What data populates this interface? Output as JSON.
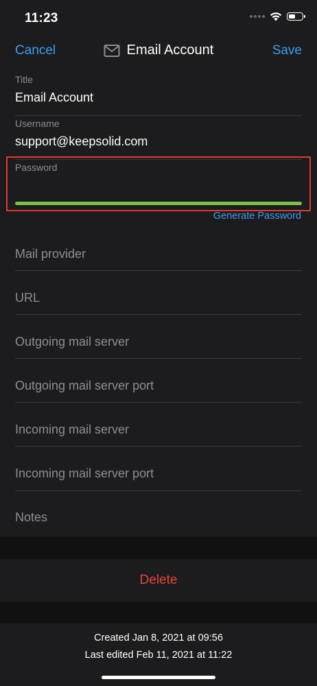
{
  "status_bar": {
    "time": "11:23",
    "battery_level_percent": 55,
    "icons": [
      "cellular-dots-icon",
      "wifi-icon",
      "battery-icon"
    ]
  },
  "nav": {
    "cancel_label": "Cancel",
    "title": "Email Account",
    "title_icon": "mail-icon",
    "save_label": "Save",
    "accent_color": "#3c9cf0"
  },
  "fields": {
    "title": {
      "label": "Title",
      "value": "Email Account"
    },
    "username": {
      "label": "Username",
      "value": "support@keepsolid.com"
    },
    "password": {
      "label": "Password",
      "value": "",
      "strength_color": "#7cc04a",
      "strength_fraction": 1.0
    }
  },
  "generate_password_label": "Generate Password",
  "optional_fields": [
    {
      "placeholder": "Mail provider"
    },
    {
      "placeholder": "URL"
    },
    {
      "placeholder": "Outgoing mail server"
    },
    {
      "placeholder": "Outgoing mail server port"
    },
    {
      "placeholder": "Incoming mail server"
    },
    {
      "placeholder": "Incoming mail server port"
    },
    {
      "placeholder": "Notes"
    }
  ],
  "delete_label": "Delete",
  "delete_color": "#e5443a",
  "highlight_color": "#e0392c",
  "footer": {
    "created": "Created Jan 8, 2021 at 09:56",
    "edited": "Last edited Feb 11, 2021 at 11:22"
  }
}
